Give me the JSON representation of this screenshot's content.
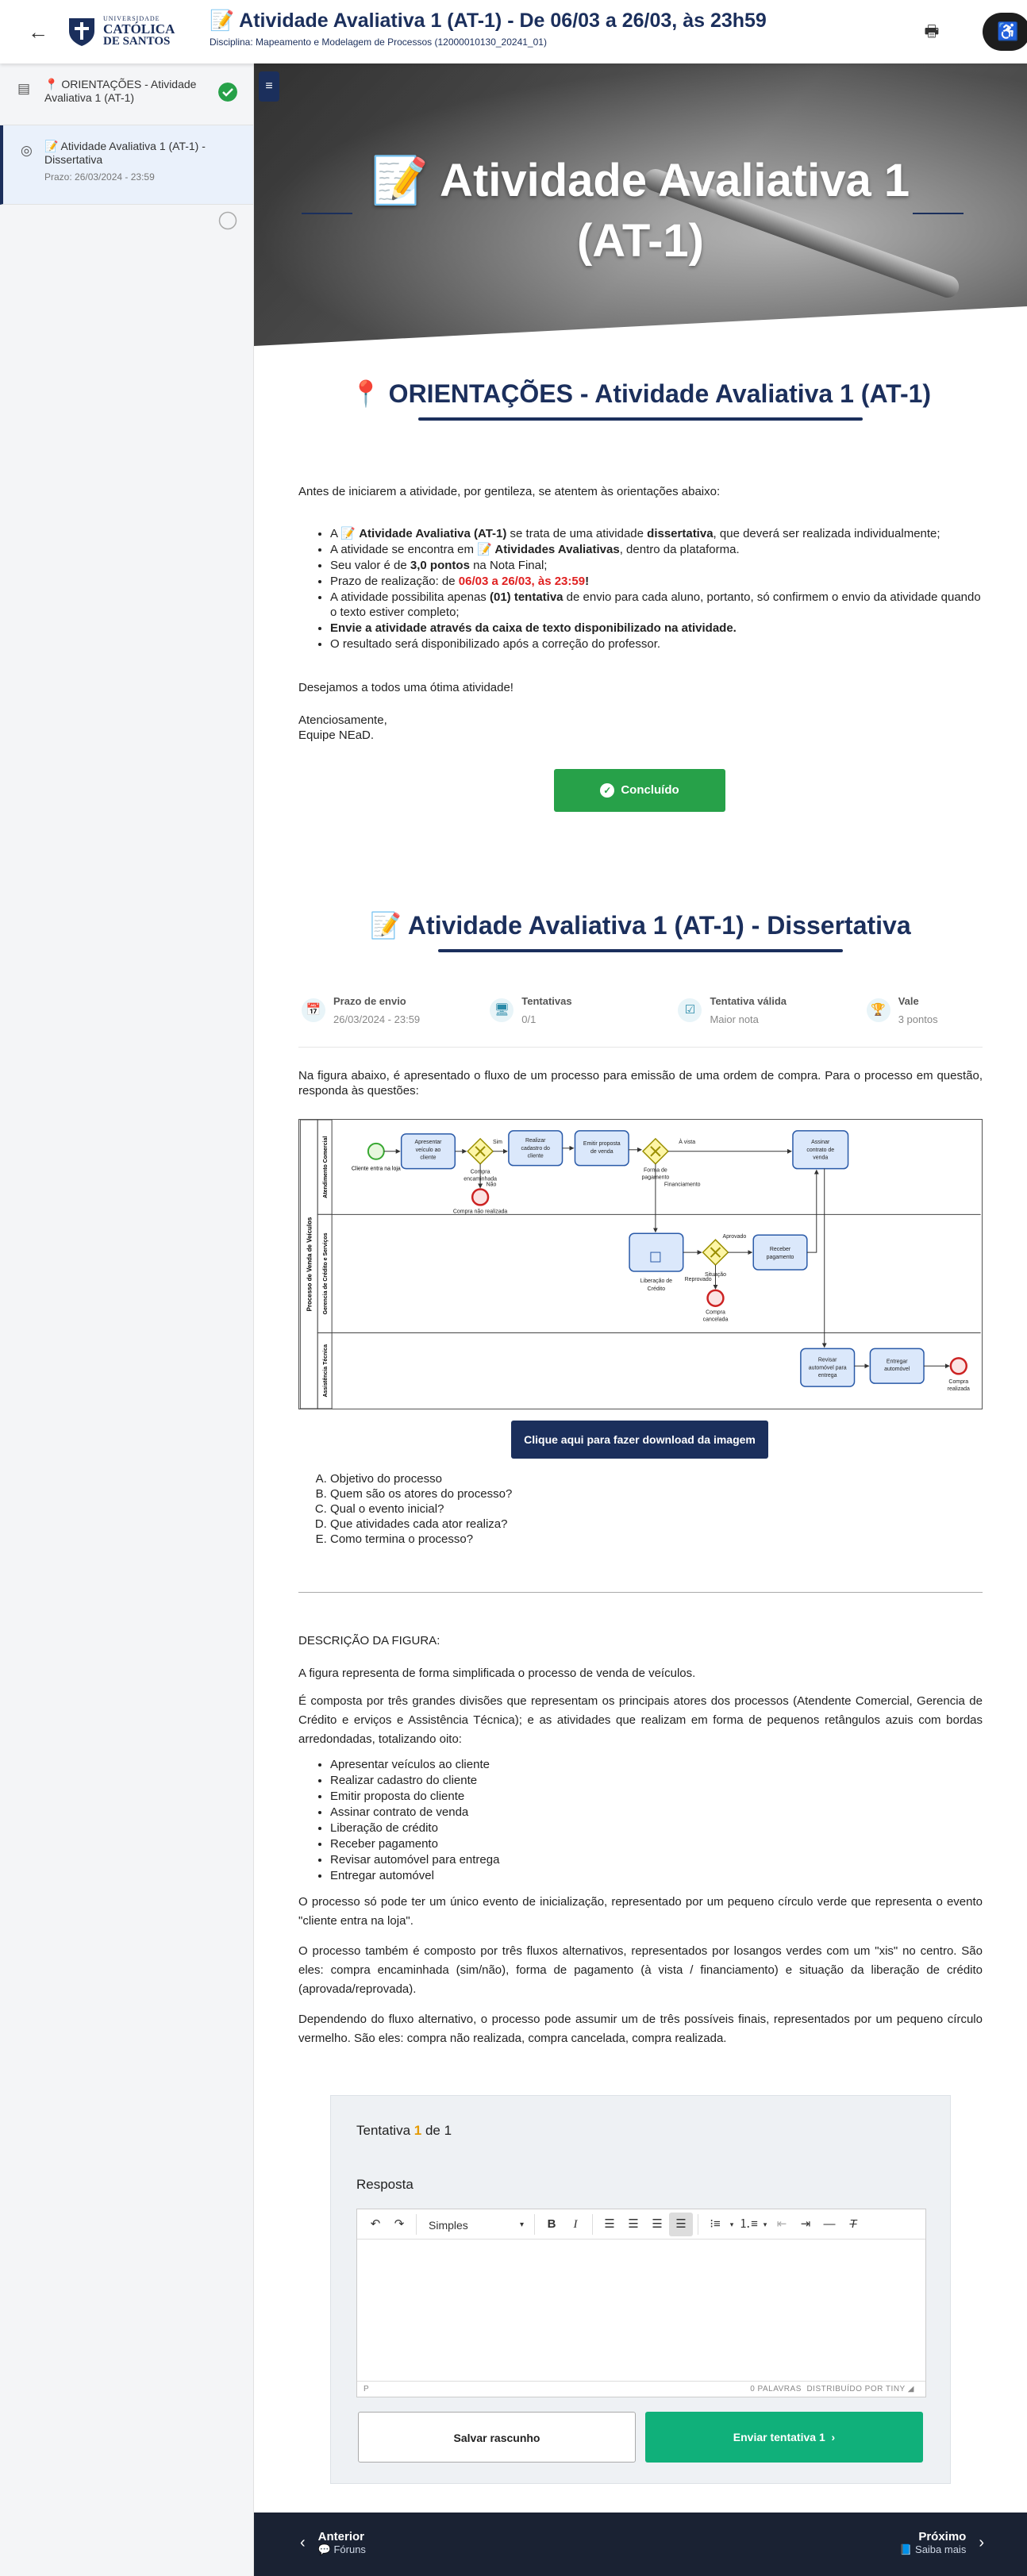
{
  "header": {
    "back_icon": "arrow-left-icon",
    "logo": {
      "line1": "UNIVERSIDADE",
      "line2": "CATÓLICA",
      "line3": "DE SANTOS"
    },
    "title": "📝 Atividade Avaliativa 1 (AT-1) - De 06/03 a 26/03, às 23h59",
    "subtitle": "Disciplina: Mapeamento e Modelagem de Processos (12000010130_20241_01)",
    "print_icon": "printer-icon",
    "accessibility_icon": "accessibility-icon"
  },
  "sidebar": {
    "items": [
      {
        "label": "📍 ORIENTAÇÕES - Atividade Avaliativa 1 (AT-1)",
        "status": "completed",
        "icon": "document-icon"
      },
      {
        "label": "📝 Atividade Avaliativa 1 (AT-1) - Dissertativa",
        "date": "Prazo: 26/03/2024 - 23:59",
        "status": "pending",
        "icon": "target-icon"
      }
    ]
  },
  "hero": {
    "title": "📝 Atividade Avaliativa 1 (AT-1)"
  },
  "orientacoes": {
    "heading": "📍 ORIENTAÇÕES - Atividade Avaliativa 1 (AT-1)",
    "intro": "Antes de iniciarem a atividade, por gentileza, se atentem às orientações abaixo:",
    "b1a": "A 📝 ",
    "b1b": "Atividade Avaliativa (AT-1)",
    "b1c": " se trata de uma atividade ",
    "b1d": "dissertativa",
    "b1e": ", que deverá ser realizada individualmente;",
    "b2a": "A atividade se encontra em ",
    "b2b": "📝 Atividades Avaliativas",
    "b2c": ", dentro da plataforma.",
    "b3a": "Seu valor é de ",
    "b3b": "3,0 pontos",
    "b3c": " na Nota Final;",
    "b4a": "Prazo de realização: de ",
    "b4b": "06/03 a 26/03, às 23:59",
    "b4c": "!",
    "b5a": "A atividade possibilita apenas ",
    "b5b": "(01) tentativa",
    "b5c": " de envio para cada aluno, portanto, só confirmem o envio da atividade quando o texto estiver completo;",
    "b6": "Envie a atividade através da caixa de texto disponibilizado na atividade.",
    "b7": "O resultado será disponibilizado após a correção do professor.",
    "closing1": "Desejamos a todos uma ótima atividade!",
    "closing2": "Atenciosamente,",
    "closing3": "Equipe NEaD.",
    "done_button": "Concluído"
  },
  "dissertativa": {
    "heading": "📝 Atividade Avaliativa 1 (AT-1) - Dissertativa",
    "meta": [
      {
        "label": "Prazo de envio",
        "value": "26/03/2024 - 23:59",
        "icon": "calendar-icon"
      },
      {
        "label": "Tentativas",
        "value": "0/1",
        "icon": "monitor-icon"
      },
      {
        "label": "Tentativa válida",
        "value": "Maior nota",
        "icon": "checklist-icon"
      },
      {
        "label": "Vale",
        "value": "3 pontos",
        "icon": "trophy-icon"
      }
    ],
    "intro": "Na figura abaixo, é apresentado o fluxo de um processo para emissão de uma ordem de compra. Para o processo em questão, responda às questões:",
    "download_button": "Clique aqui para fazer download da imagem",
    "questions": [
      "Objetivo do processo",
      "Quem são os atores do processo?",
      "Qual o evento inicial?",
      "Que atividades cada ator realiza?",
      "Como termina o processo?"
    ],
    "desc_title": "DESCRIÇÃO DA FIGURA:",
    "desc_p1": "A figura representa de forma simplificada o processo de venda de veículos.",
    "desc_p2": "É composta por três grandes divisões que representam os principais atores dos processos (Atendente Comercial, Gerencia de Crédito e erviços e Assistência Técnica); e as atividades que realizam em forma de pequenos retângulos azuis com bordas arredondadas, totalizando oito:",
    "activities": [
      "Apresentar veículos ao cliente",
      "Realizar cadastro do cliente",
      "Emitir proposta do cliente",
      "Assinar contrato de venda",
      "Liberação de crédito",
      "Receber pagamento",
      "Revisar automóvel para entrega",
      "Entregar automóvel"
    ],
    "desc_p3": "O processo só pode ter um único evento de inicialização, representado por um pequeno círculo verde que representa o evento \"cliente entra na loja\".",
    "desc_p4": "O processo também é composto por três fluxos alternativos, representados por losangos verdes com um \"xis\" no centro. São eles: compra encaminhada (sim/não), forma de pagamento (à vista / financiamento) e situação da liberação de crédito (aprovada/reprovada).",
    "desc_p5": "Dependendo do fluxo alternativo, o processo pode assumir um de três possíveis finais, representados por um pequeno círculo vermelho. São eles: compra não realizada, compra cancelada, compra realizada."
  },
  "bpmn": {
    "pool": "Processo de Venda de Veículos",
    "lanes": [
      "Atendimento Comercial",
      "Gerencia de Crédito e Serviços",
      "Assistência Técnica"
    ],
    "start": "Cliente entra na loja",
    "t1": [
      "Apresentar",
      "veículo ao",
      "cliente"
    ],
    "t2": [
      "Realizar",
      "cadastro do",
      "cliente"
    ],
    "t3": [
      "Emitir proposta",
      "de venda"
    ],
    "t4": [
      "Assinar",
      "contrato de",
      "venda"
    ],
    "t5": [
      "Liberação de",
      "Crédito"
    ],
    "t6": [
      "Receber",
      "pagamento"
    ],
    "t7": [
      "Revisar",
      "automóvel para",
      "entrega"
    ],
    "t8": [
      "Entregar",
      "automóvel"
    ],
    "g1_label": [
      "Compra",
      "encaminhada"
    ],
    "yes": "Sim",
    "no": "Não",
    "end1": "Compra não realizada",
    "g2_label": [
      "Forma de",
      "pagamento"
    ],
    "a_vista": "À vista",
    "financ": "Financiamento",
    "g3_label": "Situação",
    "aprovado": "Aprovado",
    "reprovado": "Reprovado",
    "end2": [
      "Compra",
      "cancelada"
    ],
    "end3": [
      "Compra",
      "realizada"
    ]
  },
  "attempt": {
    "title_pre": "Tentativa ",
    "title_num": "1",
    "title_post": " de 1",
    "response_label": "Resposta",
    "format_select": "Simples",
    "status_path": "P",
    "word_count": "0 PALAVRAS",
    "powered": "DISTRIBUÍDO POR TINY",
    "save_button": "Salvar rascunho",
    "send_button": "Enviar tentativa 1"
  },
  "footer": {
    "prev_title": "Anterior",
    "prev_sub": "💬 Fóruns",
    "next_title": "Próximo",
    "next_sub": "📘 Saiba mais"
  },
  "colors": {
    "brand": "#1b2f5c",
    "success": "#27a149",
    "send": "#10b07a",
    "deadline": "#e02020"
  }
}
